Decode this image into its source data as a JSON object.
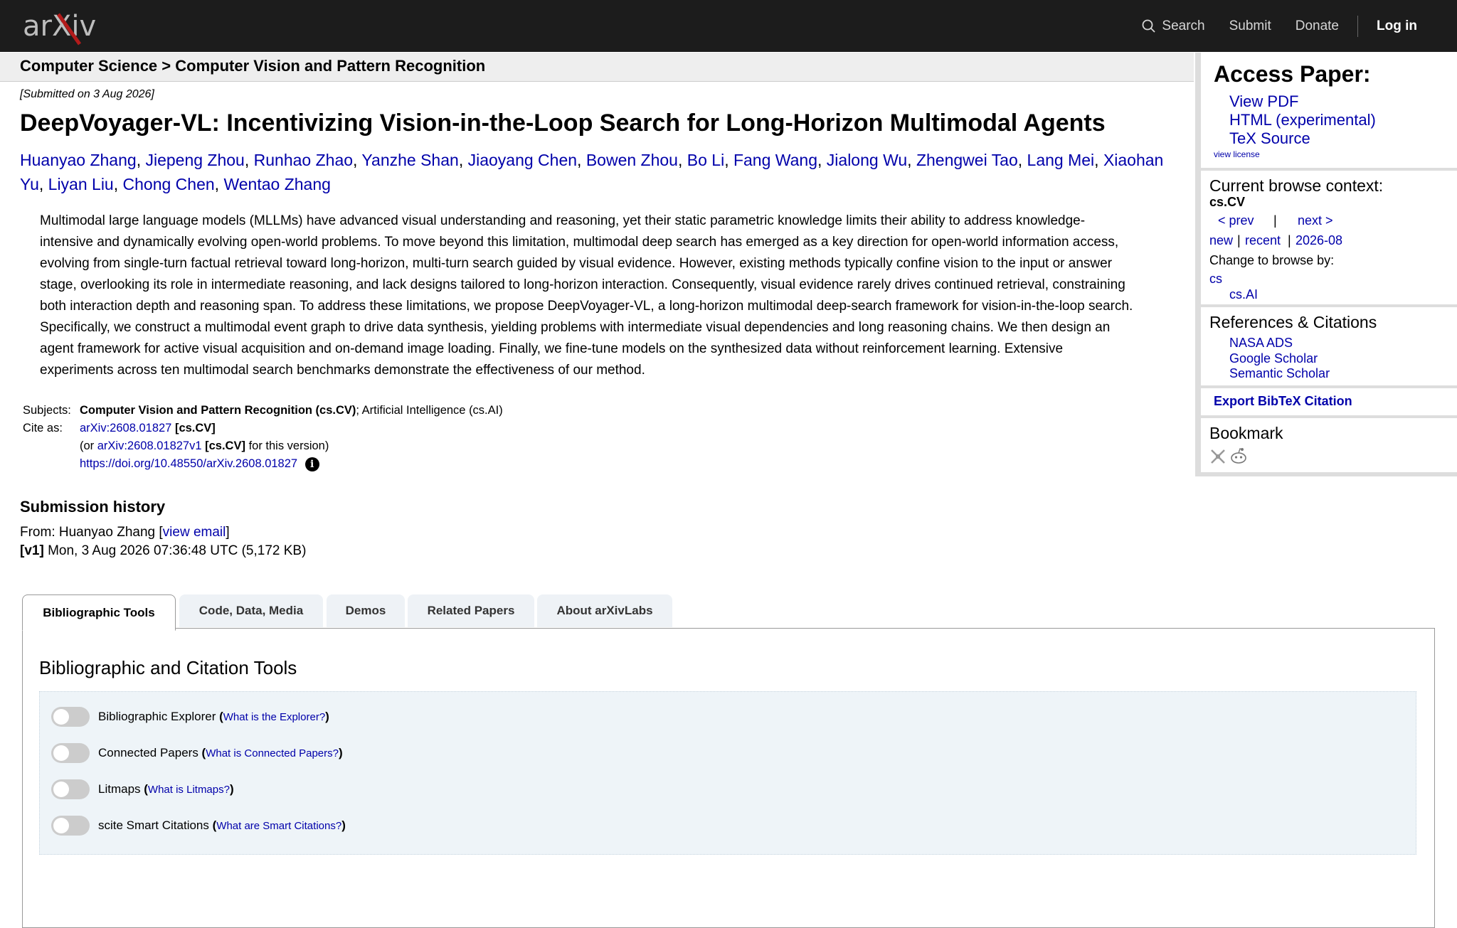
{
  "header": {
    "logo_text": "arXiv",
    "nav": {
      "search": "Search",
      "submit": "Submit",
      "donate": "Donate",
      "login": "Log in"
    }
  },
  "breadcrumb": "Computer Science > Computer Vision and Pattern Recognition",
  "paper": {
    "submitted": "[Submitted on 3 Aug 2026]",
    "title": "DeepVoyager-VL: Incentivizing Vision-in-the-Loop Search for Long-Horizon Multimodal Agents",
    "authors": [
      "Huanyao Zhang",
      "Jiepeng Zhou",
      "Runhao Zhao",
      "Yanzhe Shan",
      "Jiaoyang Chen",
      "Bowen Zhou",
      "Bo Li",
      "Fang Wang",
      "Jialong Wu",
      "Zhengwei Tao",
      "Lang Mei",
      "Xiaohan Yu",
      "Liyan Liu",
      "Chong Chen",
      "Wentao Zhang"
    ],
    "abstract_lines": [
      "Multimodal large language models (MLLMs) have advanced visual understanding and reasoning, yet their static parametric knowledge limits their ability to address knowledge-",
      "intensive and dynamically evolving open-world problems. To move beyond this limitation, multimodal deep search has emerged as a key direction for open-world information access,",
      "evolving from single-turn factual retrieval toward long-horizon, multi-turn search guided by visual evidence. However, existing methods typically confine vision to the input or answer",
      "stage, overlooking its role in intermediate reasoning, and lack designs tailored to long-horizon interaction. Consequently, visual evidence rarely drives continued retrieval, constraining",
      "both interaction depth and reasoning span. To address these limitations, we propose DeepVoyager-VL, a long-horizon multimodal deep-search framework for vision-in-the-loop search.",
      "Specifically, we construct a multimodal event graph to drive data synthesis, yielding problems with intermediate visual dependencies and long reasoning chains. We then design an",
      "agent framework for active visual acquisition and on-demand image loading. Finally, we fine-tune models on the synthesized data without reinforcement learning. Extensive",
      "experiments across ten multimodal search benchmarks demonstrate the effectiveness of our method."
    ],
    "subjects_label": "Subjects:",
    "subjects_primary": "Computer Vision and Pattern Recognition (cs.CV)",
    "subjects_rest": "; Artificial Intelligence (cs.AI)",
    "cite_label": "Cite as:",
    "cite_id": "arXiv:2608.01827",
    "cite_tag": "[cs.CV]",
    "cite_or": "(or ",
    "cite_v1": "arXiv:2608.01827v1",
    "cite_v1_tag": "[cs.CV]",
    "cite_v1_suffix": " for this version)",
    "doi": "https://doi.org/10.48550/arXiv.2608.01827",
    "info_icon": "i"
  },
  "history": {
    "heading": "Submission history",
    "from_prefix": "From: Huanyao Zhang [",
    "view_email": "view email",
    "from_suffix": "]",
    "v1_label": "[v1]",
    "v1_text": " Mon, 3 Aug 2026 07:36:48 UTC (5,172 KB)"
  },
  "sidebar": {
    "access_heading": "Access Paper:",
    "links": [
      "View PDF",
      "HTML (experimental)",
      "TeX Source"
    ],
    "view_license": "view license",
    "context_heading": "Current browse context:",
    "context_value": "cs.CV",
    "prev": "< prev",
    "pipe": "|",
    "next": "next >",
    "new": "new",
    "recent": "recent",
    "month": "2026-08",
    "sep": "|",
    "change_browse": "Change to browse by:",
    "browse_cs": "cs",
    "browse_csai": "cs.AI",
    "refs_heading": "References & Citations",
    "refs": [
      "NASA ADS",
      "Google Scholar",
      "Semantic Scholar"
    ],
    "export_bibtex": "Export BibTeX Citation",
    "bookmark_heading": "Bookmark"
  },
  "tabs": [
    "Bibliographic Tools",
    "Code, Data, Media",
    "Demos",
    "Related Papers",
    "About arXivLabs"
  ],
  "tools": {
    "heading": "Bibliographic and Citation Tools",
    "rows": [
      {
        "label": "Bibliographic Explorer",
        "q": "What is the Explorer?"
      },
      {
        "label": "Connected Papers",
        "q": "What is Connected Papers?"
      },
      {
        "label": "Litmaps",
        "q": "What is Litmaps?"
      },
      {
        "label": "scite Smart Citations",
        "q": "What are Smart Citations?"
      }
    ]
  },
  "colors": {
    "header_bg": "#1c1c1c",
    "link": "#0000aa",
    "logo_red": "#b31b1b"
  }
}
